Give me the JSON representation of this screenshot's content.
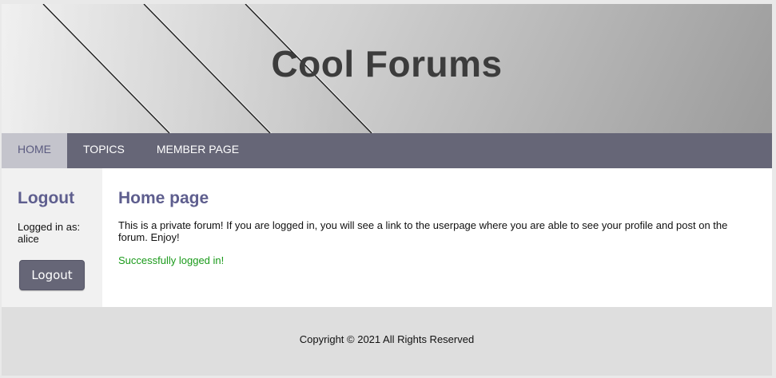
{
  "header": {
    "site_title": "Cool Forums"
  },
  "nav": {
    "items": [
      {
        "label": "HOME",
        "active": true
      },
      {
        "label": "TOPICS",
        "active": false
      },
      {
        "label": "MEMBER PAGE",
        "active": false
      }
    ]
  },
  "sidebar": {
    "heading": "Logout",
    "logged_in_label": "Logged in as:",
    "username": "alice",
    "logout_button_label": "Logout"
  },
  "main": {
    "heading": "Home page",
    "intro": "This is a private forum! If you are logged in, you will see a link to the userpage where you are able to see your profile and post on the forum. Enjoy!",
    "status_message": "Successfully logged in!"
  },
  "footer": {
    "copyright": "Copyright © 2021 All Rights Reserved"
  },
  "colors": {
    "nav_background": "#666677",
    "nav_active_background": "#c4c4cc",
    "heading_color": "#5e5e8e",
    "success_color": "#1a9a1a"
  }
}
